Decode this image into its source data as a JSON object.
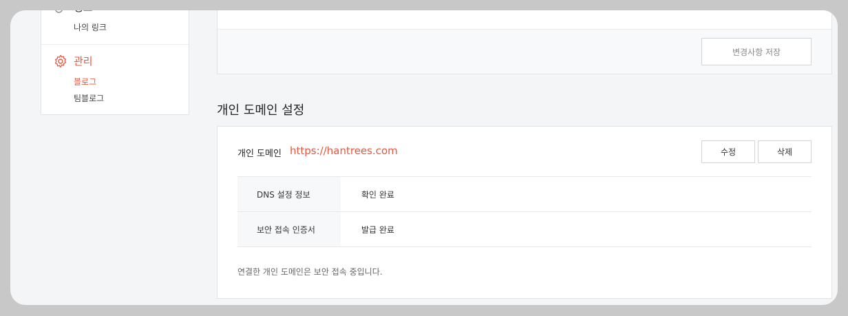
{
  "sidebar": {
    "group_link": {
      "title": "링크",
      "icon": "link-icon",
      "items": [
        {
          "label": "나의 링크"
        }
      ]
    },
    "group_manage": {
      "title": "관리",
      "icon": "gear-icon",
      "items": [
        {
          "label": "블로그",
          "active": true
        },
        {
          "label": "팀블로그"
        }
      ]
    }
  },
  "top_section": {
    "save_label": "변경사항 저장"
  },
  "domain_section": {
    "title": "개인 도메인 설정",
    "label": "개인 도메인",
    "url": "https://hantrees.com",
    "edit_label": "수정",
    "delete_label": "삭제",
    "rows": [
      {
        "key": "DNS 설정 정보",
        "value": "확인 완료"
      },
      {
        "key": "보안 접속 인증서",
        "value": "발급 완료"
      }
    ],
    "note": "연결한 개인 도메인은 보안 접속 중입니다."
  },
  "colors": {
    "accent": "#e8563f",
    "background": "#f4f5f6",
    "backdrop": "#c8c8c8"
  }
}
